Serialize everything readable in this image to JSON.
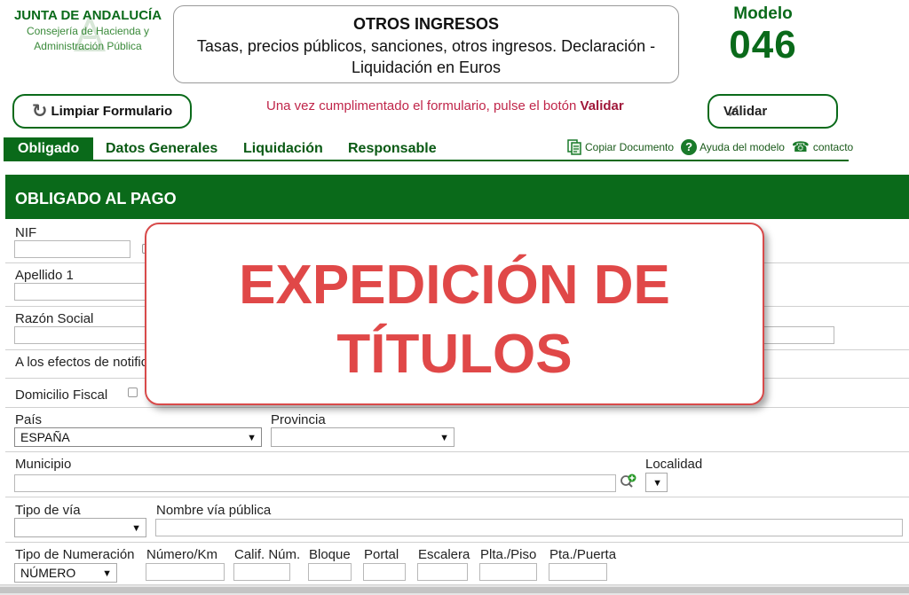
{
  "header": {
    "org": "JUNTA DE ANDALUCÍA",
    "org_sub1": "Consejería de Hacienda y",
    "org_sub2": "Administración Pública",
    "title": "OTROS INGRESOS",
    "subtitle": "Tasas, precios públicos, sanciones, otros ingresos. Declaración - Liquidación en Euros",
    "modelo_label": "Modelo",
    "modelo_number": "046"
  },
  "actions": {
    "clear_label": "Limpiar Formulario",
    "notice_prefix": "Una vez cumplimentado el formulario, pulse el botón ",
    "notice_strong": "Validar",
    "validate_label": "Validar"
  },
  "tabs": [
    "Obligado",
    "Datos Generales",
    "Liquidación",
    "Responsable"
  ],
  "tools": {
    "copy": "Copiar Documento",
    "help": "Ayuda del modelo",
    "contact": "contacto"
  },
  "section": {
    "title": "OBLIGADO AL PAGO",
    "fields": {
      "nif": "NIF",
      "apellido1": "Apellido 1",
      "razon_social": "Razón Social",
      "notif": "A los efectos de notific",
      "domicilio": "Domicilio Fiscal",
      "pais": "País",
      "pais_value": "ESPAÑA",
      "provincia": "Provincia",
      "municipio": "Municipio",
      "localidad": "Localidad",
      "tipo_via": "Tipo de vía",
      "nombre_via": "Nombre vía pública",
      "tipo_numeracion": "Tipo de Numeración",
      "tipo_numeracion_value": "NÚMERO",
      "numero_km": "Número/Km",
      "calif_num": "Calif. Núm.",
      "bloque": "Bloque",
      "portal": "Portal",
      "escalera": "Escalera",
      "plta_piso": "Plta./Piso",
      "pta_puerta": "Pta./Puerta"
    }
  },
  "overlay": {
    "line1": "EXPEDICIÓN DE",
    "line2": "TÍTULOS"
  },
  "colors": {
    "brand_green": "#0a6a1a",
    "notice_red": "#c0264a",
    "overlay_red": "#e04848"
  }
}
